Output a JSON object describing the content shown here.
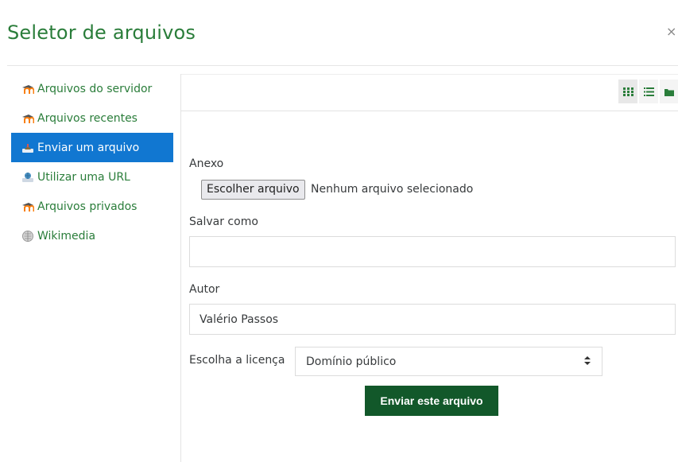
{
  "dialog": {
    "title": "Seletor de arquivos",
    "close_glyph": "×"
  },
  "sidebar": {
    "items": [
      {
        "label": "Arquivos do servidor",
        "icon": "moodle-icon",
        "active": false
      },
      {
        "label": "Arquivos recentes",
        "icon": "moodle-icon",
        "active": false
      },
      {
        "label": "Enviar um arquivo",
        "icon": "upload-icon",
        "active": true
      },
      {
        "label": "Utilizar uma URL",
        "icon": "url-icon",
        "active": false
      },
      {
        "label": "Arquivos privados",
        "icon": "moodle-icon",
        "active": false
      },
      {
        "label": "Wikimedia",
        "icon": "wikimedia-icon",
        "active": false
      }
    ]
  },
  "toolbar": {
    "views": [
      {
        "name": "icon-view",
        "icon": "grid-icon",
        "selected": true
      },
      {
        "name": "list-view",
        "icon": "list-icon",
        "selected": false
      },
      {
        "name": "tree-view",
        "icon": "folder-icon",
        "selected": false
      }
    ]
  },
  "form": {
    "attachment_label": "Anexo",
    "choose_file_label": "Escolher arquivo",
    "no_file_text": "Nenhum arquivo selecionado",
    "save_as_label": "Salvar como",
    "save_as_value": "",
    "author_label": "Autor",
    "author_value": "Valério Passos",
    "license_label": "Escolha a licença",
    "license_value": "Domínio público",
    "submit_label": "Enviar este arquivo"
  },
  "colors": {
    "brand_green": "#2a7d3a",
    "active_blue": "#1177d1",
    "submit_green": "#12582a",
    "moodle_orange": "#f98012"
  }
}
